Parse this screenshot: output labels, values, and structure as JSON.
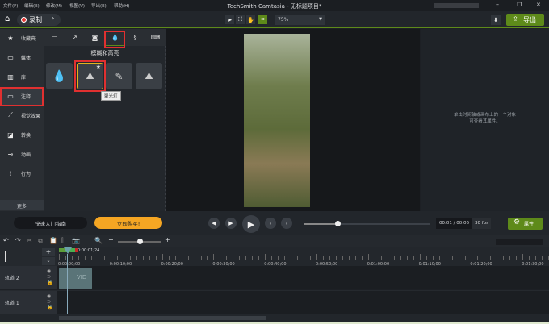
{
  "menu": [
    "文件(F)",
    "编辑(E)",
    "修改(M)",
    "视图(V)",
    "导出(E)",
    "帮助(H)"
  ],
  "window_title": "TechSmith Camtasia - 无标题项目*",
  "toolbar": {
    "record_label": "录制",
    "zoom_value": "75%",
    "export_label": "导出"
  },
  "sidebar": {
    "items": [
      {
        "label": "收藏夹",
        "icon": "star-icon"
      },
      {
        "label": "媒体",
        "icon": "film-icon"
      },
      {
        "label": "库",
        "icon": "library-icon"
      },
      {
        "label": "注释",
        "icon": "annotation-icon"
      },
      {
        "label": "视觉效果",
        "icon": "magic-wand-icon"
      },
      {
        "label": "转换",
        "icon": "transition-icon"
      },
      {
        "label": "动画",
        "icon": "animation-icon"
      },
      {
        "label": "行为",
        "icon": "behavior-icon"
      }
    ],
    "more_label": "更多"
  },
  "panel": {
    "title": "模糊和高亮",
    "tooltip": "聚光灯"
  },
  "properties": {
    "hint_line1": "单击时间轴或画布上的一个对象",
    "hint_line2": "可查看其属性。"
  },
  "bottom": {
    "quick_guide": "快速入门指南",
    "buy_now": "立即购买!",
    "time": "00:01 / 00:06",
    "fps": "30 fps",
    "properties_label": "属性"
  },
  "timeline": {
    "playhead_time": "0:00:01;24",
    "ticks": [
      "0:00:00;00",
      "0:00:10;00",
      "0:00:20;00",
      "0:00:30;00",
      "0:00:40;00",
      "0:00:50;00",
      "0:01:00;00",
      "0:01:10;00",
      "0:01:20;00",
      "0:01:30;00"
    ],
    "tracks": [
      {
        "label": "轨道 2",
        "clip": "VID"
      },
      {
        "label": "轨道 1"
      }
    ]
  },
  "colors": {
    "accent_green": "#5e8a1a",
    "buy_orange": "#f5a623",
    "highlight_red": "#e03030"
  }
}
